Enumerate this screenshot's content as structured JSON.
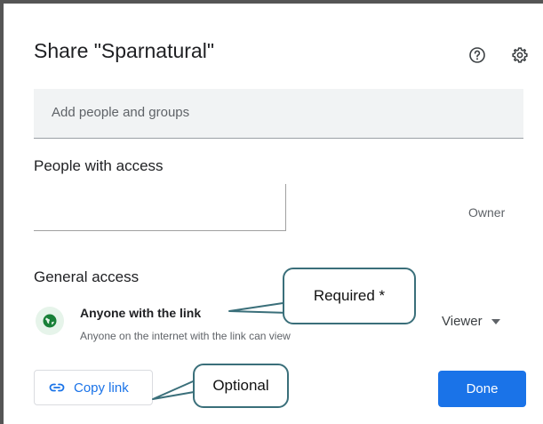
{
  "dialog": {
    "title": "Share \"Sparnatural\"",
    "add_people_placeholder": "Add people and groups"
  },
  "icons": {
    "help": "help-circle-icon",
    "settings": "gear-icon",
    "globe": "globe-icon",
    "link": "link-icon",
    "dropdown": "caret-down-icon"
  },
  "people_with_access": {
    "heading": "People with access",
    "owner_label": "Owner"
  },
  "general_access": {
    "heading": "General access",
    "option_title": "Anyone with the link",
    "option_desc": "Anyone on the internet with the link can view",
    "role": "Viewer"
  },
  "actions": {
    "copy_link": "Copy link",
    "done": "Done"
  },
  "annotations": {
    "required": "Required *",
    "optional": "Optional"
  },
  "colors": {
    "accent": "#1a73e8",
    "globe_bg": "#e6f4ea",
    "globe_fg": "#188038",
    "callout_border": "#3a6f7a"
  }
}
